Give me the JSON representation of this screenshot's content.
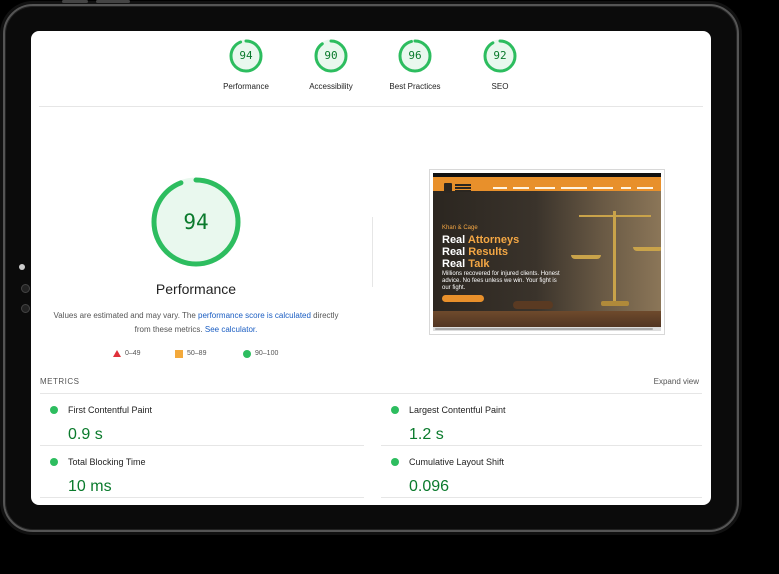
{
  "scores": [
    {
      "label": "Performance",
      "value": "94",
      "fraction": 0.94
    },
    {
      "label": "Accessibility",
      "value": "90",
      "fraction": 0.9
    },
    {
      "label": "Best Practices",
      "value": "96",
      "fraction": 0.96
    },
    {
      "label": "SEO",
      "value": "92",
      "fraction": 0.92
    }
  ],
  "main": {
    "score": "94",
    "fraction": 0.94,
    "title": "Performance",
    "desc_prefix": "Values are estimated and may vary. The ",
    "desc_link1": "performance score is calculated",
    "desc_middle": " directly from these metrics. ",
    "desc_link2": "See calculator."
  },
  "legend": [
    {
      "range": "0–49",
      "shape": "triangle",
      "color": "#e0303a"
    },
    {
      "range": "50–89",
      "shape": "square",
      "color": "#f3a93b"
    },
    {
      "range": "90–100",
      "shape": "circle",
      "color": "#2dbd5f"
    }
  ],
  "site_preview": {
    "brand": "Khan & Cage",
    "lines": [
      {
        "a": "Real ",
        "b": "Attorneys"
      },
      {
        "a": "Real ",
        "b": "Results"
      },
      {
        "a": "Real ",
        "b": "Talk"
      }
    ],
    "copy": "Millions recovered for injured clients. Honest advice. No fees unless we win. Your fight is our fight."
  },
  "metrics": {
    "heading": "METRICS",
    "expand_label": "Expand view",
    "items": [
      {
        "name": "First Contentful Paint",
        "value": "0.9 s"
      },
      {
        "name": "Largest Contentful Paint",
        "value": "1.2 s"
      },
      {
        "name": "Total Blocking Time",
        "value": "10 ms"
      },
      {
        "name": "Cumulative Layout Shift",
        "value": "0.096"
      }
    ]
  },
  "colors": {
    "pass_green": "#2dbd5f",
    "pass_text": "#0a7a2c",
    "gauge_fill": "#e9f8ee",
    "link": "#1a5dc2"
  }
}
